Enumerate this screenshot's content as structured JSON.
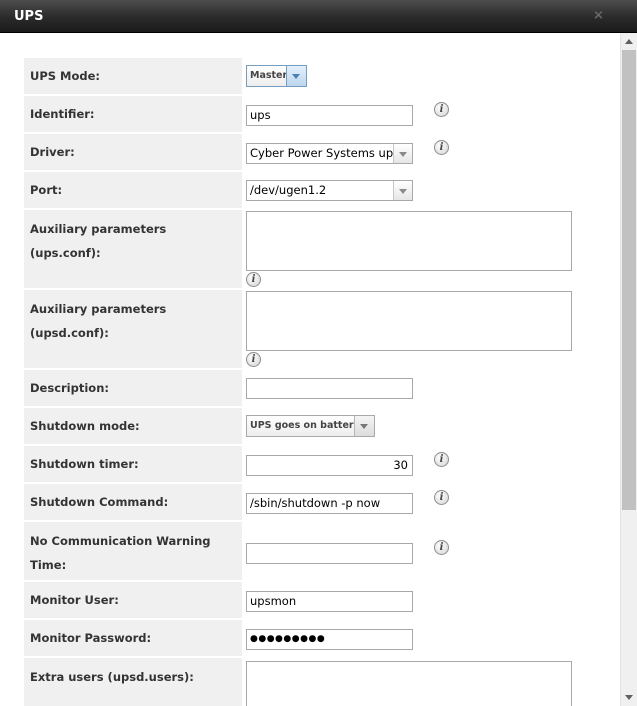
{
  "dialog": {
    "title": "UPS",
    "close_glyph": "⨯"
  },
  "form": {
    "ups_mode": {
      "label": "UPS Mode:",
      "value": "Master"
    },
    "identifier": {
      "label": "Identifier:",
      "value": "ups"
    },
    "driver": {
      "label": "Driver:",
      "value": "Cyber Power Systems ups"
    },
    "port": {
      "label": "Port:",
      "value": "/dev/ugen1.2"
    },
    "aux_ups": {
      "label_line1": "Auxiliary parameters",
      "label_line2": "(ups.conf):",
      "value": ""
    },
    "aux_upsd": {
      "label_line1": "Auxiliary parameters",
      "label_line2": "(upsd.conf):",
      "value": ""
    },
    "description": {
      "label": "Description:",
      "value": ""
    },
    "shutdown_mode": {
      "label": "Shutdown mode:",
      "value": "UPS goes on battery"
    },
    "shutdown_timer": {
      "label": "Shutdown timer:",
      "value": "30"
    },
    "shutdown_command": {
      "label": "Shutdown Command:",
      "value": "/sbin/shutdown -p now"
    },
    "nocomm_warning": {
      "label_line1": "No Communication Warning",
      "label_line2": "Time:",
      "value": ""
    },
    "monitor_user": {
      "label": "Monitor User:",
      "value": "upsmon"
    },
    "monitor_password": {
      "label": "Monitor Password:",
      "value": "●●●●●●●●●"
    },
    "extra_users": {
      "label": "Extra users (upsd.users):",
      "value": ""
    }
  },
  "icons": {
    "info_glyph": "i",
    "info_icon_name": "info-icon",
    "close_icon_name": "close-icon"
  }
}
